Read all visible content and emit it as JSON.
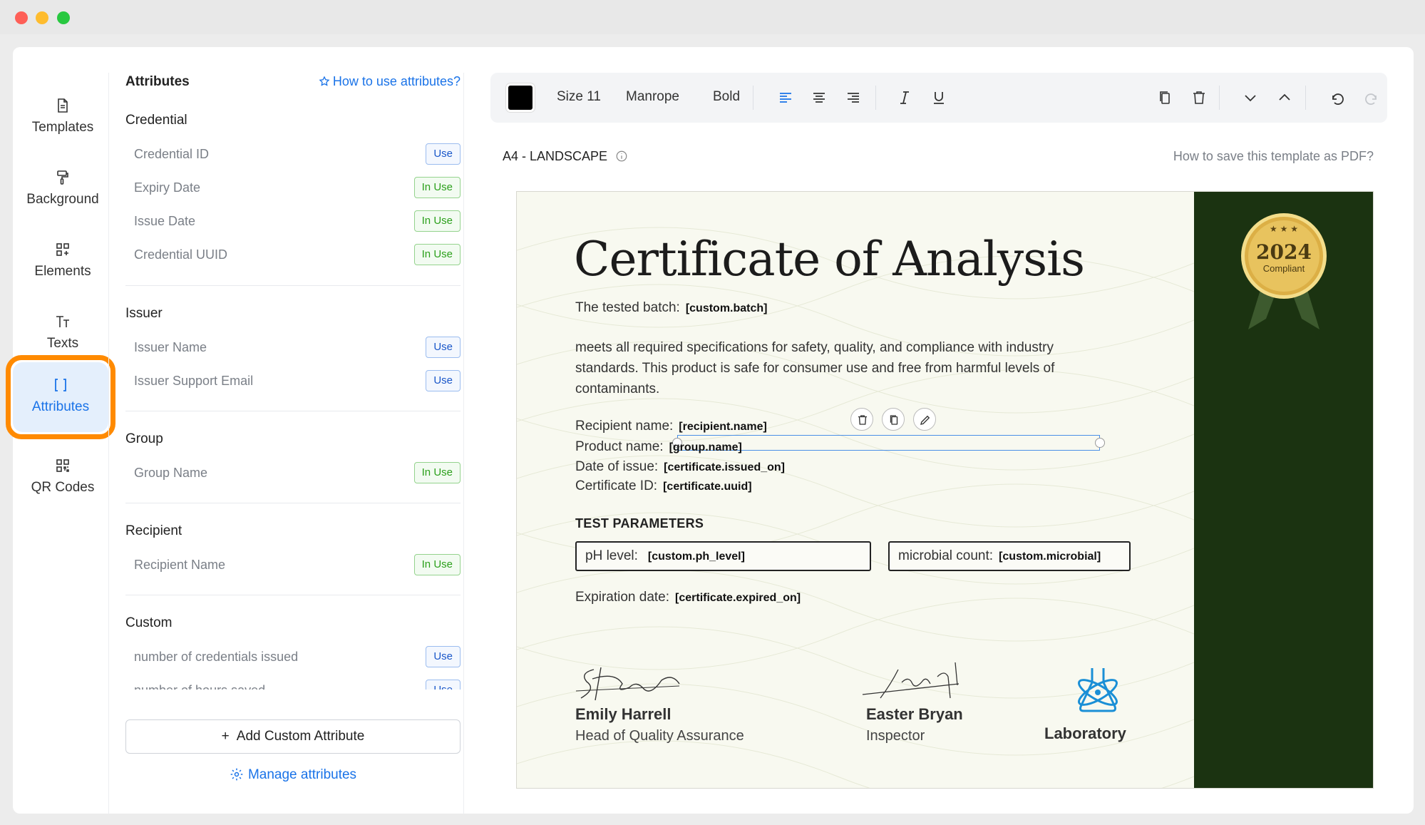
{
  "nav": {
    "items": [
      {
        "label": "Templates",
        "icon": "file-icon"
      },
      {
        "label": "Background",
        "icon": "paint-roller-icon"
      },
      {
        "label": "Elements",
        "icon": "grid-plus-icon"
      },
      {
        "label": "Texts",
        "icon": "text-size-icon"
      },
      {
        "label": "Attributes",
        "icon": "brackets-icon",
        "active": true
      },
      {
        "label": "QR Codes",
        "icon": "qr-code-icon"
      }
    ]
  },
  "panel": {
    "title": "Attributes",
    "help_link": "How to use attributes?",
    "sections": [
      {
        "title": "Credential",
        "items": [
          {
            "name": "Credential ID",
            "status": "Use"
          },
          {
            "name": "Expiry Date",
            "status": "In Use"
          },
          {
            "name": "Issue Date",
            "status": "In Use"
          },
          {
            "name": "Credential UUID",
            "status": "In Use"
          }
        ]
      },
      {
        "title": "Issuer",
        "items": [
          {
            "name": "Issuer Name",
            "status": "Use"
          },
          {
            "name": "Issuer Support Email",
            "status": "Use"
          }
        ]
      },
      {
        "title": "Group",
        "items": [
          {
            "name": "Group Name",
            "status": "In Use"
          }
        ]
      },
      {
        "title": "Recipient",
        "items": [
          {
            "name": "Recipient Name",
            "status": "In Use"
          }
        ]
      },
      {
        "title": "Custom",
        "items": [
          {
            "name": "number of credentials issued",
            "status": "Use"
          },
          {
            "name": "number of hours saved",
            "status": "Use"
          }
        ]
      }
    ],
    "add_button": "Add Custom Attribute",
    "add_button_icon": "+",
    "manage_link": "Manage attributes"
  },
  "toolbar": {
    "color": "#000000",
    "size": "Size 11",
    "font": "Manrope",
    "weight": "Bold"
  },
  "canvas": {
    "paper_size": "A4 - LANDSCAPE",
    "save_help": "How to save this template as PDF?"
  },
  "certificate": {
    "title": "Certificate of Analysis",
    "batch_label": "The tested batch:",
    "batch_tag": "[custom.batch]",
    "paragraph": "meets all required specifications for safety, quality, and compliance with industry standards. This product is safe for consumer use and free from harmful levels of contaminants.",
    "fields": [
      {
        "label": "Recipient name:",
        "tag": "[recipient.name]"
      },
      {
        "label": "Product name:",
        "tag": "[group.name]"
      },
      {
        "label": "Date of issue:",
        "tag": "[certificate.issued_on]"
      },
      {
        "label": "Certificate ID:",
        "tag": "[certificate.uuid]"
      }
    ],
    "test_title": "TEST PARAMETERS",
    "ph_label": "pH level:",
    "ph_tag": "[custom.ph_level]",
    "micro_label": "microbial count:",
    "micro_tag": "[custom.microbial]",
    "expiry_label": "Expiration date:",
    "expiry_tag": "[certificate.expired_on]",
    "signatories": [
      {
        "name": "Emily Harrell",
        "role": "Head of Quality Assurance"
      },
      {
        "name": "Easter Bryan",
        "role": "Inspector"
      }
    ],
    "lab_name": "Laboratory",
    "medal_year": "2024",
    "medal_text": "Compliant",
    "colors": {
      "band": "#1b3311",
      "medal": "#e0b54a",
      "accent": "#1a73e8",
      "highlight": "#ff8a00"
    }
  }
}
